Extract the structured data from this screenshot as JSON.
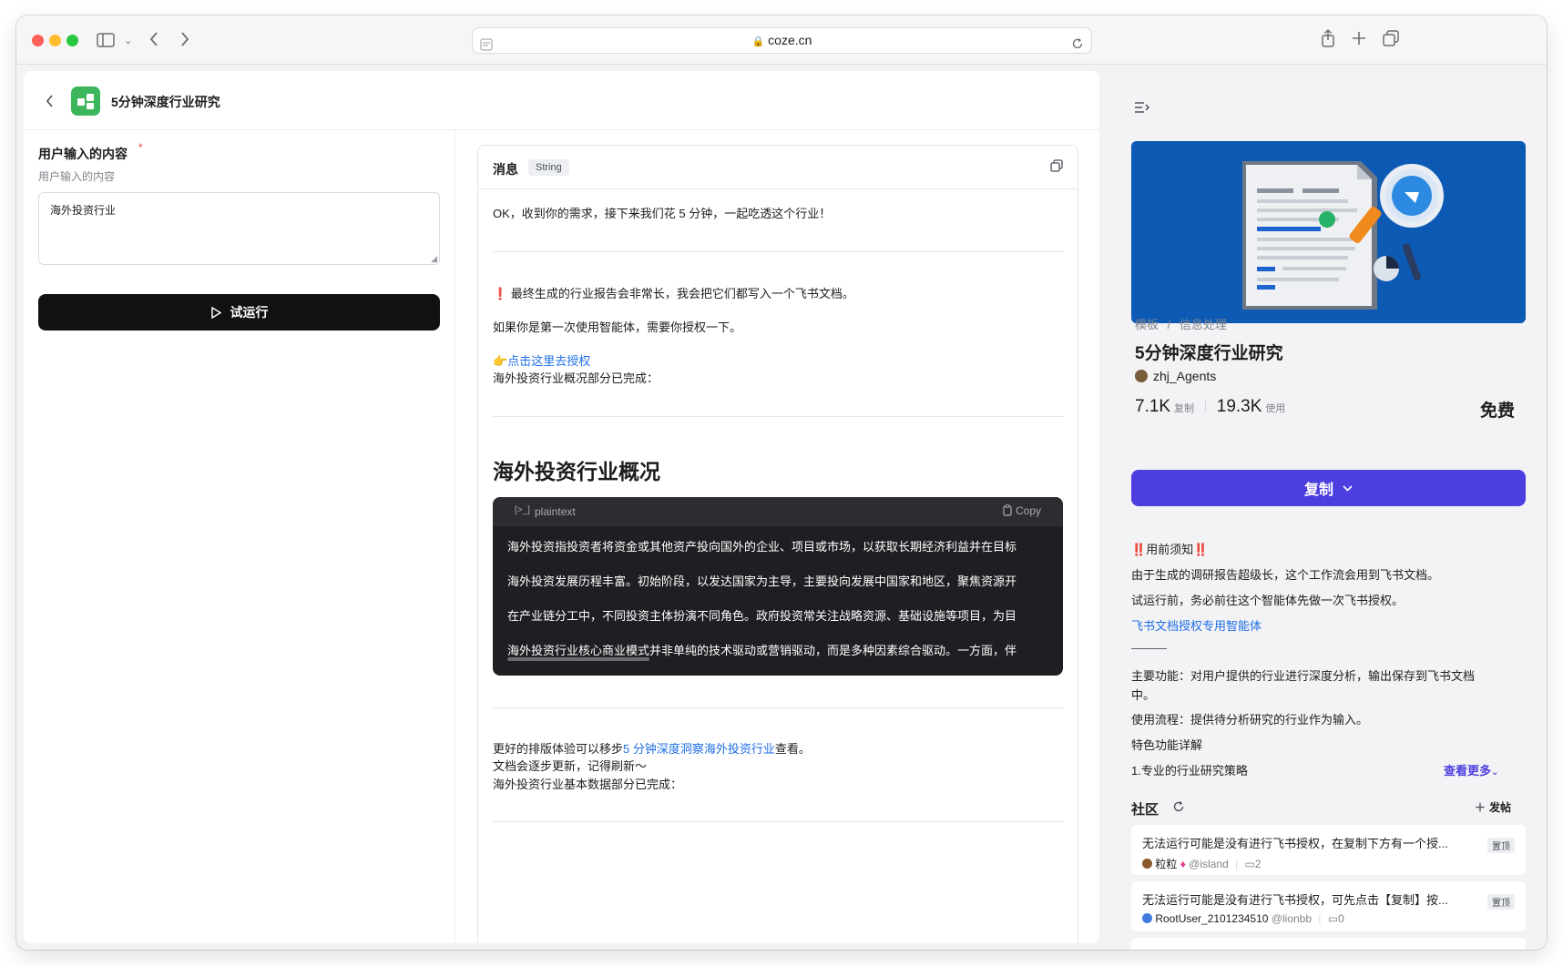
{
  "browser": {
    "url": "coze.cn"
  },
  "header": {
    "title": "5分钟深度行业研究"
  },
  "input_panel": {
    "label": "用户输入的内容",
    "required_mark": "*",
    "description": "用户输入的内容",
    "value": "海外投资行业",
    "run_label": "试运行"
  },
  "message": {
    "title": "消息",
    "type_badge": "String",
    "intro": "OK，收到你的需求，接下来我们花 5 分钟，一起吃透这个行业！",
    "warning_icon": "❗",
    "warning": "最终生成的行业报告会非常长，我会把它们都写入一个飞书文档。",
    "first_use": "如果你是第一次使用智能体，需要你授权一下。",
    "auth_emoji": "👉",
    "auth_link": "点击这里去授权",
    "overview_done": "海外投资行业概况部分已完成：",
    "section_title": "海外投资行业概况",
    "code": {
      "lang_icon": "[>_]",
      "lang": "plaintext",
      "copy": "Copy",
      "lines": [
        "海外投资指投资者将资金或其他资产投向国外的企业、项目或市场，以获取长期经济利益并在目标",
        "海外投资发展历程丰富。初始阶段，以发达国家为主导，主要投向发展中国家和地区，聚焦资源开",
        "在产业链分工中，不同投资主体扮演不同角色。政府投资常关注战略资源、基础设施等项目，为目",
        "海外投资行业核心商业模式并非单纯的技术驱动或营销驱动，而是多种因素综合驱动。一方面，伴"
      ]
    },
    "better_prefix": "更好的排版体验可以移步",
    "better_link": "5 分钟深度洞察海外投资行业",
    "better_suffix": "查看。",
    "update_note": "文档会逐步更新，记得刷新～",
    "basic_done": "海外投资行业基本数据部分已完成："
  },
  "sidebar": {
    "breadcrumb_root": "模板",
    "breadcrumb_sep": "/",
    "breadcrumb_leaf": "信息处理",
    "title": "5分钟深度行业研究",
    "author": "zhj_Agents",
    "copies": "7.1K",
    "copies_label": "复制",
    "uses": "19.3K",
    "uses_label": "使用",
    "price": "免费",
    "copy_button": "复制",
    "notice_icon": "‼️",
    "notice_title": "用前须知",
    "notice_1": "由于生成的调研报告超级长，这个工作流会用到飞书文档。",
    "notice_2": "试运行前，务必前往这个智能体先做一次飞书授权。",
    "notice_link": "飞书文档授权专用智能体",
    "divider_text": "———",
    "main_func_1": "主要功能：对用户提供的行业进行深度分析，输出保存到飞书文档",
    "main_func_2": "中。",
    "usage": "使用流程：提供待分析研究的行业作为输入。",
    "features": "特色功能详解",
    "feature_1": "1.专业的行业研究策略",
    "more": "查看更多",
    "community": "社区",
    "post_button": "发帖",
    "posts": [
      {
        "title": "无法运行可能是没有进行飞书授权，在复制下方有一个授...",
        "badge": "置顶",
        "author": "粒粒",
        "handle": "@island",
        "comments": "2"
      },
      {
        "title": "无法运行可能是没有进行飞书授权，可先点击【复制】按...",
        "badge": "置顶",
        "author": "RootUser_2101234510",
        "handle": "@lionbb",
        "comments": "0"
      }
    ]
  },
  "colors": {
    "accent": "#4d3ee0",
    "link": "#1f6fe5",
    "run_button": "#111114",
    "hero": "#0d5ab4",
    "logo": "#3cb65a"
  }
}
